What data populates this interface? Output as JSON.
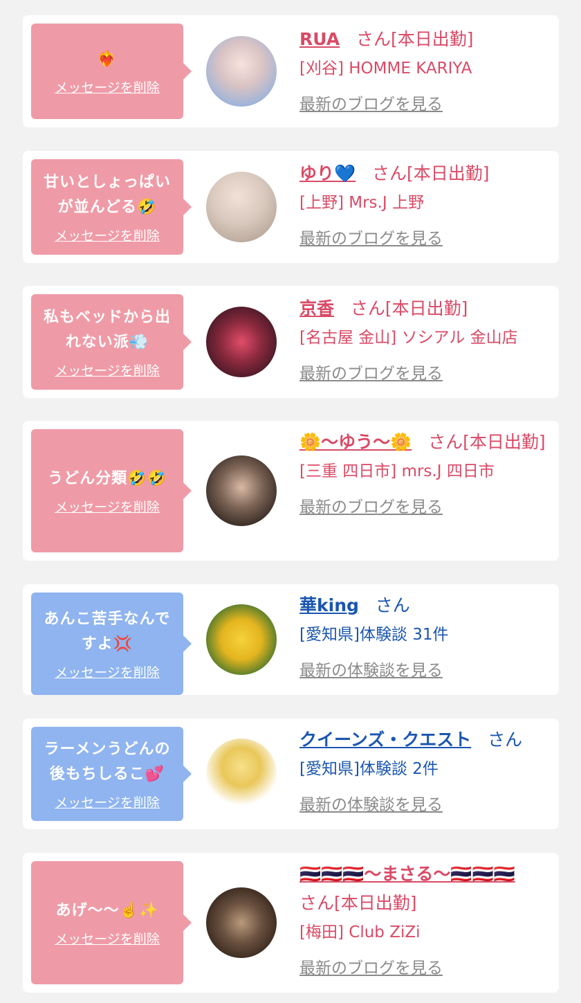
{
  "items": [
    {
      "theme": "pink",
      "message": "❤️‍🔥",
      "delete_label": "メッセージを削除",
      "name": "RUA",
      "san": "さん[本日出勤]",
      "shop": "[刈谷] HOMME KARIYA",
      "link": "最新のブログを見る"
    },
    {
      "theme": "pink",
      "message": "甘いとしょっぱいが並んどる🤣",
      "delete_label": "メッセージを削除",
      "name": "ゆり💙",
      "san": "さん[本日出勤]",
      "shop": "[上野] Mrs.J 上野",
      "link": "最新のブログを見る"
    },
    {
      "theme": "pink",
      "message": "私もベッドから出れない派💨",
      "delete_label": "メッセージを削除",
      "name": "京香",
      "san": "さん[本日出勤]",
      "shop": "[名古屋 金山] ソシアル 金山店",
      "link": "最新のブログを見る"
    },
    {
      "theme": "pink",
      "message": "うどん分類🤣🤣",
      "delete_label": "メッセージを削除",
      "name": "🌼〜ゆう〜🌼",
      "san": "さん[本日出勤]",
      "shop": "[三重 四日市] mrs.J 四日市",
      "link": "最新のブログを見る"
    },
    {
      "theme": "blue",
      "message": "あんこ苦手なんですよ💢",
      "delete_label": "メッセージを削除",
      "name": "華king",
      "san": "さん",
      "shop": "[愛知県]体験談 31件",
      "link": "最新の体験談を見る"
    },
    {
      "theme": "blue",
      "message": "ラーメンうどんの後もちしるこ💕",
      "delete_label": "メッセージを削除",
      "name": "クイーンズ・クエスト",
      "san": "さん",
      "shop": "[愛知県]体験談 2件",
      "link": "最新の体験談を見る"
    },
    {
      "theme": "pink",
      "message": "あげ〜〜☝️✨",
      "delete_label": "メッセージを削除",
      "name": "🇹🇭🇹🇭🇹🇭〜まさる〜🇹🇭🇹🇭🇹🇭",
      "san": "さん[本日出勤]",
      "shop": "[梅田] Club ZiZi",
      "link": "最新のブログを見る"
    }
  ],
  "colors": {
    "pink_bubble": "#ef9ba7",
    "blue_bubble": "#8fb4ef",
    "pink_text": "#d94a66",
    "blue_text": "#1a56b0"
  }
}
